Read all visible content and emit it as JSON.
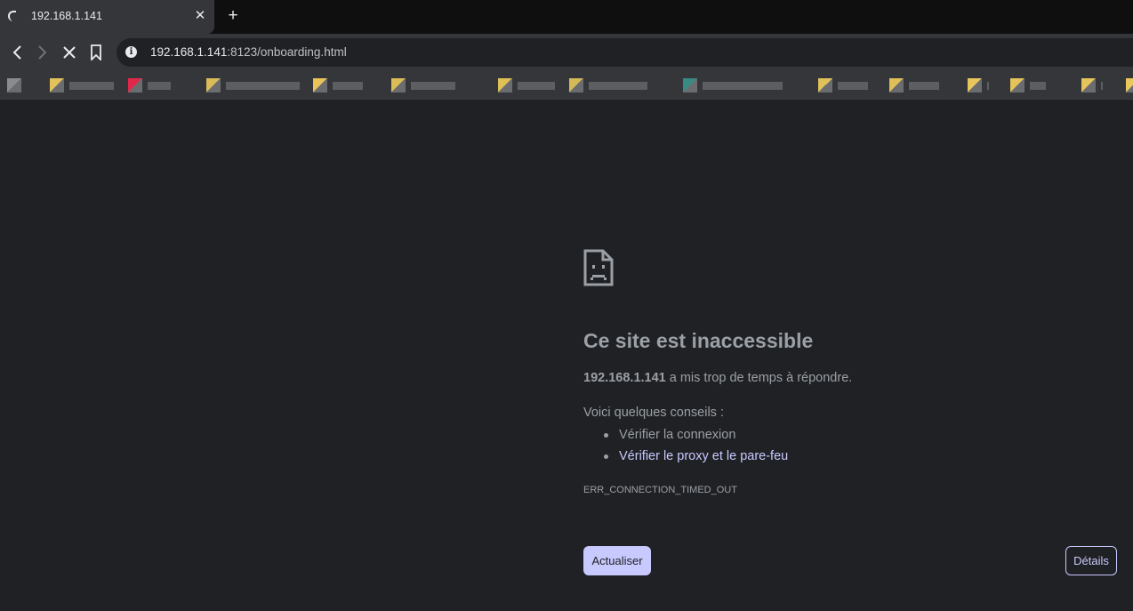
{
  "tab": {
    "title": "192.168.1.141",
    "close_icon": "close-icon",
    "new_tab_icon": "plus-icon"
  },
  "toolbar": {
    "back_icon": "chevron-left-icon",
    "forward_icon": "chevron-right-icon",
    "stop_icon": "stop-x-icon",
    "bookmark_icon": "bookmark-icon",
    "site_info_icon": "info-icon"
  },
  "address": {
    "host": "192.168.1.141",
    "rest": ":8123/onboarding.html"
  },
  "bookmarks": {
    "items": [
      {
        "icon_color": "#8a8b8f"
      },
      {
        "icon_color": "#e3c25a"
      },
      {
        "icon_color": "#e0294a"
      },
      {
        "icon_color": "#d9bb5a"
      },
      {
        "icon_color": "#e7c45a"
      },
      {
        "icon_color": "#dcbd55"
      },
      {
        "icon_color": "#dfc056"
      },
      {
        "icon_color": "#d6b957"
      },
      {
        "icon_color": "#3a8a84"
      },
      {
        "icon_color": "#e1c15a"
      },
      {
        "icon_color": "#e0bf58"
      },
      {
        "icon_color": "#e8c65c"
      },
      {
        "icon_color": "#e4c35b"
      },
      {
        "icon_color": "#e6c45c"
      },
      {
        "icon_color": "#e9c75d"
      }
    ]
  },
  "error": {
    "icon": "sad-page-icon",
    "title": "Ce site est inaccessible",
    "host": "192.168.1.141",
    "description_rest": " a mis trop de temps à répondre.",
    "tips_title": "Voici quelques conseils :",
    "tips": [
      "Vérifier la connexion",
      "Vérifier le proxy et le pare-feu"
    ],
    "code": "ERR_CONNECTION_TIMED_OUT",
    "reload_label": "Actualiser",
    "details_label": "Détails"
  },
  "colors": {
    "background": "#202124",
    "accent": "#c8c9ff",
    "text": "#9aa0a6"
  }
}
